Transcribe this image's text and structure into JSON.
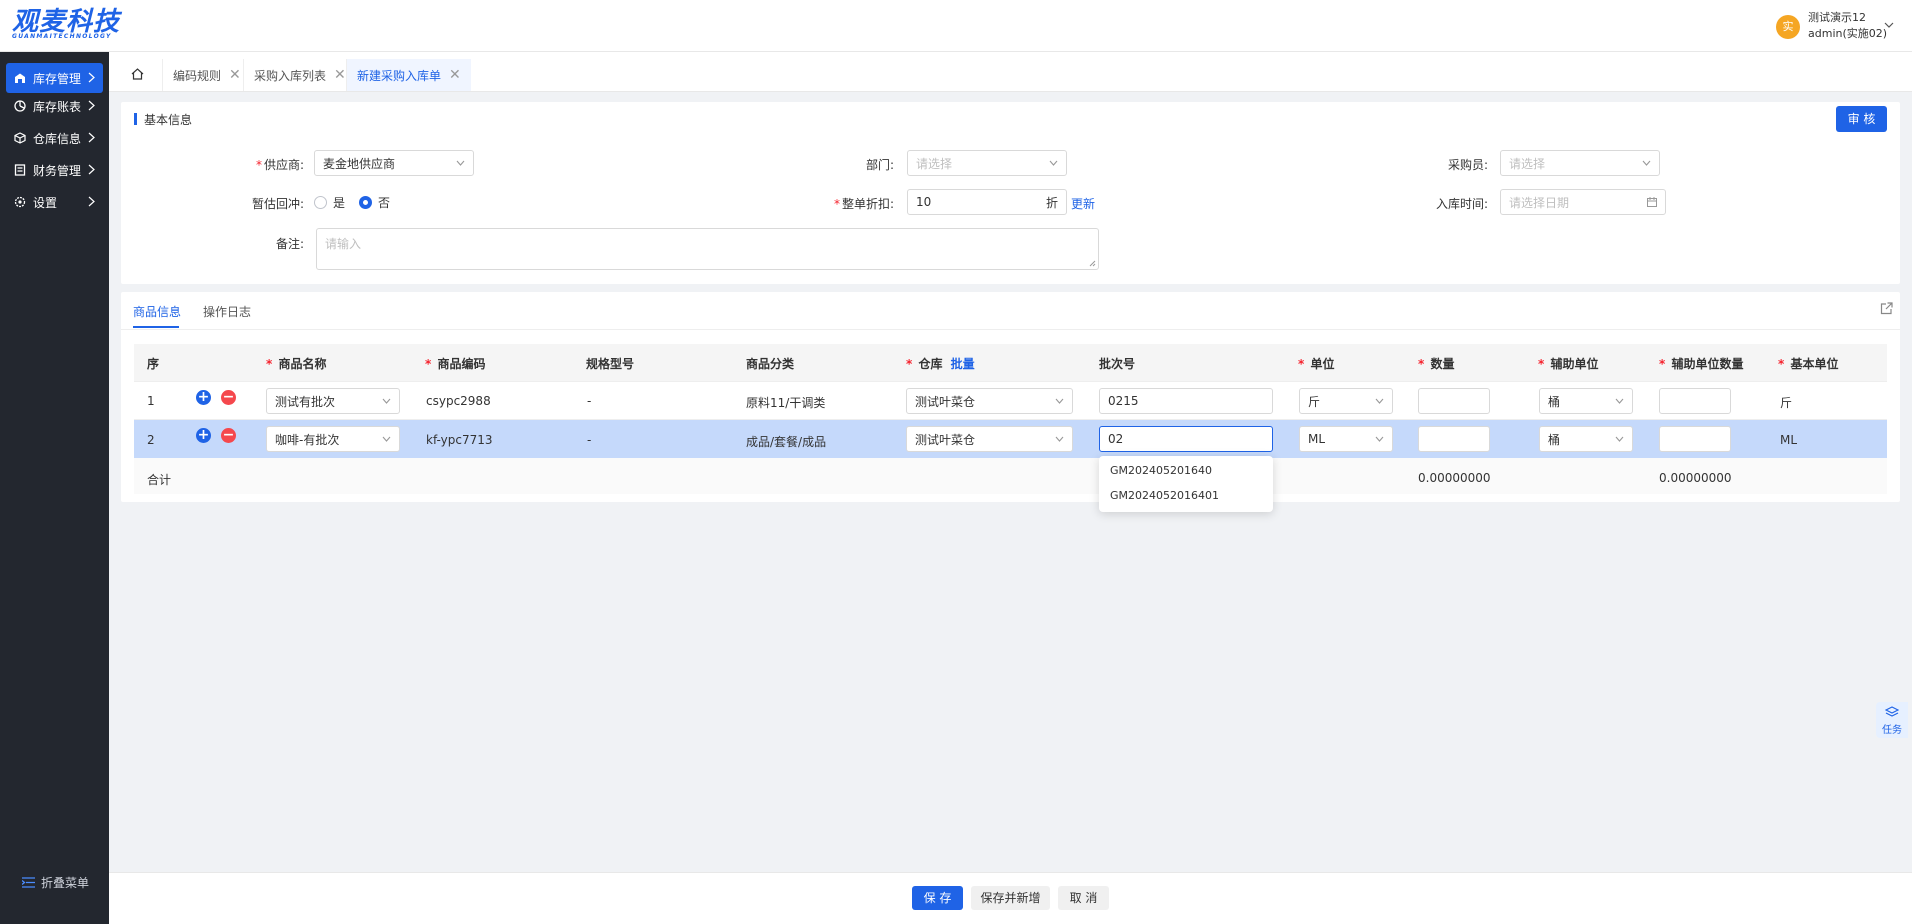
{
  "app": {
    "logo_text": "观麦科技",
    "logo_sub": "GUANMAITECHNOLOGY",
    "user_avatar_char": "实",
    "user_name": "测试演示12",
    "user_account": "admin(实施02)",
    "accent_color": "#1f63e6"
  },
  "sidebar": {
    "items": [
      {
        "label": "库存管理",
        "icon": "warehouse-icon"
      },
      {
        "label": "库存账表",
        "icon": "chart-icon"
      },
      {
        "label": "仓库信息",
        "icon": "cube-icon"
      },
      {
        "label": "财务管理",
        "icon": "ledger-icon"
      },
      {
        "label": "设置",
        "icon": "gear-icon"
      }
    ],
    "collapse_label": "折叠菜单"
  },
  "tabs": [
    {
      "label": "编码规则"
    },
    {
      "label": "采购入库列表"
    },
    {
      "label": "新建采购入库单"
    }
  ],
  "basic": {
    "title": "基本信息",
    "audit_button": "审 核",
    "supplier_label": "供应商:",
    "supplier_value": "麦金地供应商",
    "dept_label": "部门:",
    "dept_placeholder": "请选择",
    "buyer_label": "采购员:",
    "buyer_placeholder": "请选择",
    "estimate_label": "暂估回冲:",
    "yes_label": "是",
    "no_label": "否",
    "discount_label": "整单折扣:",
    "discount_value": "10",
    "discount_unit": "折",
    "update_link": "更新",
    "date_label": "入库时间:",
    "date_placeholder": "请选择日期",
    "remark_label": "备注:",
    "remark_placeholder": "请输入"
  },
  "goods": {
    "tab_info": "商品信息",
    "tab_log": "操作日志",
    "headers": {
      "seq": "序",
      "name": "商品名称",
      "code": "商品编码",
      "spec": "规格型号",
      "category": "商品分类",
      "warehouse": "仓库",
      "batch_action": "批量",
      "batch_no": "批次号",
      "unit": "单位",
      "qty": "数量",
      "aux_unit": "辅助单位",
      "aux_qty": "辅助单位数量",
      "base_unit": "基本单位"
    },
    "rows": [
      {
        "seq": "1",
        "name": "测试有批次",
        "code": "csypc2988",
        "spec": "-",
        "category": "原料11/干调类",
        "warehouse": "测试叶菜仓",
        "batch": "0215",
        "unit": "斤",
        "aux_unit": "桶",
        "base_unit": "斤"
      },
      {
        "seq": "2",
        "name": "咖啡-有批次",
        "code": "kf-ypc7713",
        "spec": "-",
        "category": "成品/套餐/成品",
        "warehouse": "测试叶菜仓",
        "batch": "02",
        "unit": "ML",
        "aux_unit": "桶",
        "base_unit": "ML"
      }
    ],
    "total_label": "合计",
    "total_qty": "0.00000000",
    "total_aux_qty": "0.00000000",
    "batch_suggestions": [
      "GM202405201640",
      "GM2024052016401"
    ]
  },
  "footer": {
    "save": "保 存",
    "save_new": "保存并新增",
    "cancel": "取 消"
  },
  "task_label": "任务"
}
